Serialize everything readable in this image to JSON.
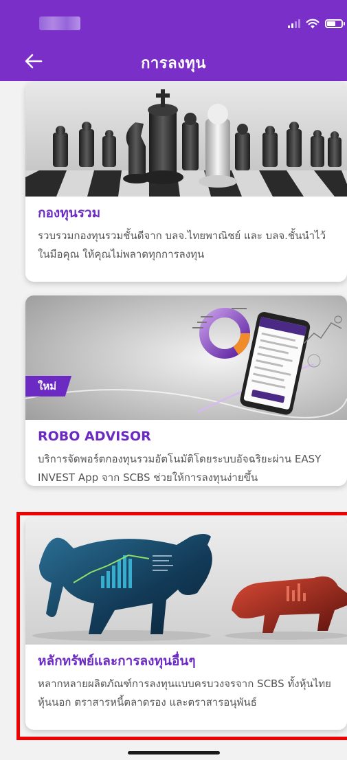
{
  "header": {
    "title": "การลงทุน",
    "color": "#7b2fc9"
  },
  "icons": [
    "back-arrow-icon",
    "signal-icon",
    "wifi-icon",
    "battery-icon"
  ],
  "cards": [
    {
      "title": "กองทุนรวม",
      "description": "รวบรวมกองทุนรวมชั้นดีจาก บลจ.ไทยพาณิชย์ และ บลจ.ชั้นนำไว้ในมือคุณ ให้คุณไม่พลาดทุกการลงทุน"
    },
    {
      "badge": "ใหม่",
      "title": "ROBO ADVISOR",
      "description": "บริการจัดพอร์ตกองทุนรวมอัตโนมัติโดยระบบอัจฉริยะผ่าน EASY INVEST App จาก SCBS ช่วยให้การลงทุนง่ายขึ้น"
    },
    {
      "title": "หลักทรัพย์และการลงทุนอื่นๆ",
      "description": "หลากหลายผลิตภัณฑ์การลงทุนแบบครบวงจรจาก SCBS ทั้งหุ้นไทย หุ้นนอก ตราสารหนี้ตลาดรอง และตราสารอนุพันธ์"
    }
  ],
  "colors": {
    "accent": "#6b2bc2",
    "highlight": "#ee0000"
  }
}
